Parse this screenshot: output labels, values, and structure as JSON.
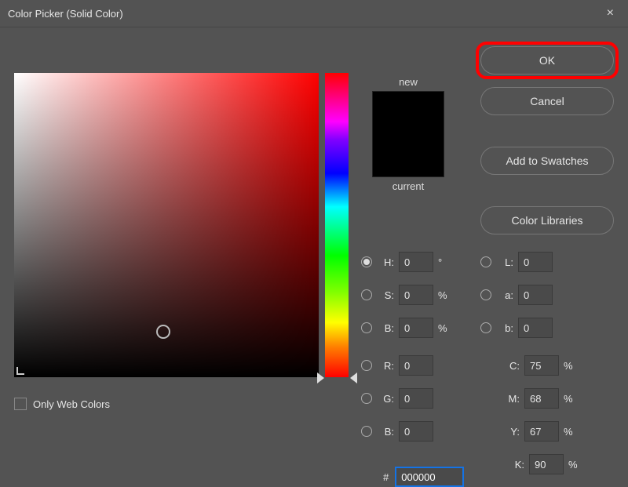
{
  "window": {
    "title": "Color Picker (Solid Color)",
    "close_label": "×"
  },
  "buttons": {
    "ok": "OK",
    "cancel": "Cancel",
    "add_swatches": "Add to Swatches",
    "color_libraries": "Color Libraries"
  },
  "swatch": {
    "new_label": "new",
    "current_label": "current",
    "new_color": "#000000",
    "current_color": "#000000"
  },
  "hsb": {
    "h": {
      "label": "H:",
      "value": "0",
      "unit": "°"
    },
    "s": {
      "label": "S:",
      "value": "0",
      "unit": "%"
    },
    "b": {
      "label": "B:",
      "value": "0",
      "unit": "%"
    }
  },
  "lab": {
    "l": {
      "label": "L:",
      "value": "0"
    },
    "a": {
      "label": "a:",
      "value": "0"
    },
    "b": {
      "label": "b:",
      "value": "0"
    }
  },
  "rgb": {
    "r": {
      "label": "R:",
      "value": "0"
    },
    "g": {
      "label": "G:",
      "value": "0"
    },
    "b": {
      "label": "B:",
      "value": "0"
    }
  },
  "cmyk": {
    "c": {
      "label": "C:",
      "value": "75",
      "unit": "%"
    },
    "m": {
      "label": "M:",
      "value": "68",
      "unit": "%"
    },
    "y": {
      "label": "Y:",
      "value": "67",
      "unit": "%"
    },
    "k": {
      "label": "K:",
      "value": "90",
      "unit": "%"
    }
  },
  "hex": {
    "hash": "#",
    "value": "000000"
  },
  "web_colors": {
    "label": "Only Web Colors",
    "checked": false
  },
  "selected_radio": "H"
}
